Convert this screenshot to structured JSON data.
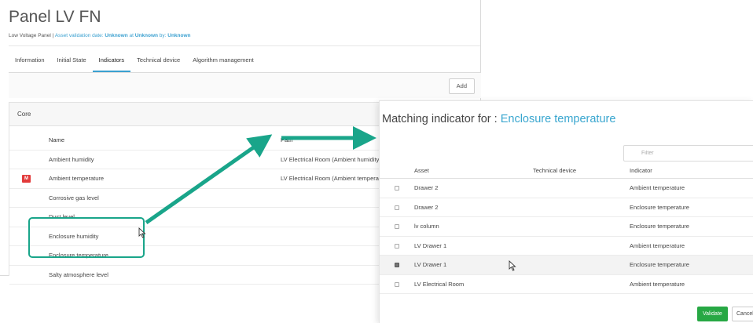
{
  "panel": {
    "title": "Panel LV FN",
    "subtitle": {
      "type": "Low Voltage Panel",
      "sep": " | ",
      "validation_prefix": "Asset validation date: ",
      "validation_date": "Unknown",
      "at": " at ",
      "validation_time": "Unknown",
      "by": " by: ",
      "validation_user": "Unknown"
    },
    "tabs": [
      {
        "label": "Information",
        "active": false
      },
      {
        "label": "Initial State",
        "active": false
      },
      {
        "label": "Indicators",
        "active": true
      },
      {
        "label": "Technical device",
        "active": false
      },
      {
        "label": "Algorithm management",
        "active": false
      }
    ],
    "add_label": "Add",
    "core": {
      "title": "Core",
      "columns": {
        "name": "Name",
        "path": "Path"
      },
      "rows": [
        {
          "name": "Ambient humidity",
          "path": "LV Electrical Room (Ambient humidity",
          "badge": ""
        },
        {
          "name": "Ambient temperature",
          "path": "LV Electrical Room (Ambient tempera",
          "badge": "M"
        },
        {
          "name": "Corrosive gas level",
          "path": "",
          "badge": ""
        },
        {
          "name": "Dust level",
          "path": "",
          "badge": ""
        },
        {
          "name": "Enclosure humidity",
          "path": "",
          "badge": ""
        },
        {
          "name": "Enclosure temperature",
          "path": "",
          "badge": ""
        },
        {
          "name": "Salty atmosphere level",
          "path": "",
          "badge": ""
        }
      ]
    }
  },
  "modal": {
    "title_prefix": "Matching indicator for : ",
    "title_target": "Enclosure temperature",
    "filter_placeholder": "Filter",
    "columns": {
      "asset": "Asset",
      "tech": "Technical device",
      "indicator": "Indicator"
    },
    "rows": [
      {
        "asset": "Drawer 2",
        "tech": "",
        "indicator": "Ambient temperature",
        "checked": false
      },
      {
        "asset": "Drawer 2",
        "tech": "",
        "indicator": "Enclosure temperature",
        "checked": false
      },
      {
        "asset": "lv column",
        "tech": "",
        "indicator": "Enclosure temperature",
        "checked": false
      },
      {
        "asset": "LV Drawer 1",
        "tech": "",
        "indicator": "Ambient temperature",
        "checked": false
      },
      {
        "asset": "LV Drawer 1",
        "tech": "",
        "indicator": "Enclosure temperature",
        "checked": true
      },
      {
        "asset": "LV Electrical Room",
        "tech": "",
        "indicator": "Ambient temperature",
        "checked": false
      }
    ],
    "validate_label": "Validate",
    "cancel_label": "Cancel"
  },
  "colors": {
    "accent": "#39a6cf",
    "annotation": "#19a58a",
    "badge": "#e23b3b",
    "validate": "#27a844"
  },
  "icons": {
    "badge_icon": "m-badge-icon",
    "cursor": "mouse-pointer-icon",
    "filter": "search-icon"
  }
}
